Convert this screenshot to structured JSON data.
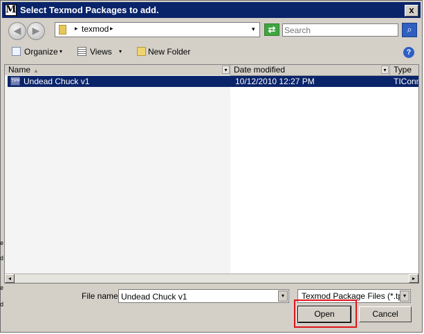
{
  "window": {
    "title": "Select Texmod Packages to add.",
    "title_icon": "M",
    "close_label": "x"
  },
  "nav": {
    "back_glyph": "◀",
    "forward_glyph": "▶",
    "address": {
      "separator": "▸",
      "folder": "texmod",
      "dropdown_glyph": "▾"
    },
    "refresh_glyph": "⇄",
    "search": {
      "placeholder": "Search"
    },
    "search_glyph": "⌕"
  },
  "toolbar": {
    "organize": "Organize",
    "views": "Views",
    "new_folder": "New Folder",
    "arrow": "▾",
    "help": "?"
  },
  "columns": {
    "name": "Name",
    "date": "Date modified",
    "type": "Type",
    "drop": "▾",
    "sort": "▲"
  },
  "files": [
    {
      "icon": "tpf-file-icon",
      "icon_text": "TPF",
      "name": "Undead Chuck v1",
      "date": "10/12/2010 12:27 PM",
      "type": "TIConne",
      "selected": true
    }
  ],
  "scrollbar": {
    "left": "◂",
    "right": "▸"
  },
  "footer": {
    "filename_label": "File name:",
    "filename_value": "Undead Chuck v1",
    "filetype_value": "Texmod Package Files (*.tpf)",
    "drop": "▾",
    "open": "Open",
    "cancel": "Cancel"
  },
  "background_fragments": [
    "e",
    "d",
    "e",
    "d"
  ],
  "colors": {
    "title_bar": "#0a246a",
    "selection": "#0a246a",
    "highlight_box": "#e0131a"
  }
}
